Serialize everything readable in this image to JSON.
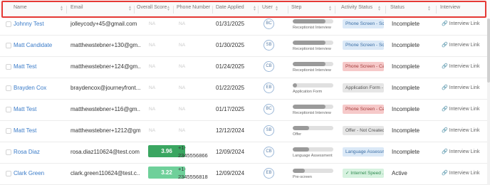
{
  "columns": [
    "Name",
    "Email",
    "Overall Score",
    "Phone Number",
    "Date Applied",
    "User",
    "Step",
    "Activity Status",
    "Status",
    "Interview"
  ],
  "interview_link_label": "Interview Link",
  "rows": [
    {
      "name": "Johnny Test",
      "email": "jolleycody+45@gmail.com",
      "score": "NA",
      "phone1": "NA",
      "phone2": "",
      "date": "01/31/2025",
      "user": "BC",
      "step_progress": 0.8,
      "step": "Receptionist Interview",
      "activity": "Phone Screen - Sch...",
      "activity_style": "blue",
      "status": "Incomplete"
    },
    {
      "name": "Matt Candidate",
      "email": "matthewstebner+130@gm...",
      "score": "NA",
      "phone1": "NA",
      "phone2": "",
      "date": "01/30/2025",
      "user": "SB",
      "step_progress": 0.8,
      "step": "Receptionist Interview",
      "activity": "Phone Screen - Sch...",
      "activity_style": "blue",
      "status": "Incomplete"
    },
    {
      "name": "Matt Test",
      "email": "matthewstebner+124@gm...",
      "score": "NA",
      "phone1": "NA",
      "phone2": "",
      "date": "01/24/2025",
      "user": "CB",
      "step_progress": 0.8,
      "step": "Receptionist Interview",
      "activity": "Phone Screen - Ca...",
      "activity_style": "red",
      "status": "Incomplete"
    },
    {
      "name": "Brayden Cox",
      "email": "braydencox@journeyfront...",
      "score": "NA",
      "phone1": "NA",
      "phone2": "",
      "date": "01/22/2025",
      "user": "EB",
      "step_progress": 0.1,
      "step": "Application Form",
      "activity": "Application Form - ...",
      "activity_style": "gray",
      "status": "Incomplete"
    },
    {
      "name": "Matt Test",
      "email": "matthewstebner+116@gm...",
      "score": "NA",
      "phone1": "NA",
      "phone2": "",
      "date": "01/17/2025",
      "user": "BC",
      "step_progress": 0.8,
      "step": "Receptionist Interview",
      "activity": "Phone Screen - Ca...",
      "activity_style": "red",
      "status": "Incomplete"
    },
    {
      "name": "Matt Test",
      "email": "matthewstebner+1212@gm...",
      "score": "NA",
      "phone1": "NA",
      "phone2": "",
      "date": "12/12/2024",
      "user": "SB",
      "step_progress": 0.4,
      "step": "Offer",
      "activity": "Offer - Not Created",
      "activity_style": "gray",
      "status": "Incomplete"
    },
    {
      "name": "Rosa Diaz",
      "email": "rosa.diaz110624@test.com",
      "score": "3.96",
      "score_color": "#3aa661",
      "phone1": "+1-",
      "phone2": "2345556866",
      "date": "12/09/2024",
      "user": "CB",
      "step_progress": 0.4,
      "step": "Language Assessment",
      "activity": "Language Assessm...",
      "activity_style": "blue",
      "status": "Incomplete"
    },
    {
      "name": "Clark Green",
      "email": "clark.green110624@test.c...",
      "score": "3.22",
      "score_color": "#6fd09a",
      "phone1": "+1-",
      "phone2": "2345556818",
      "date": "12/09/2024",
      "user": "EB",
      "step_progress": 0.3,
      "step": "Pre-screen",
      "activity": "✓ Internet Speed ...",
      "activity_style": "green",
      "status": "Active"
    }
  ],
  "colors": {
    "highlight": "#e53935",
    "link": "#3a7bc8"
  }
}
